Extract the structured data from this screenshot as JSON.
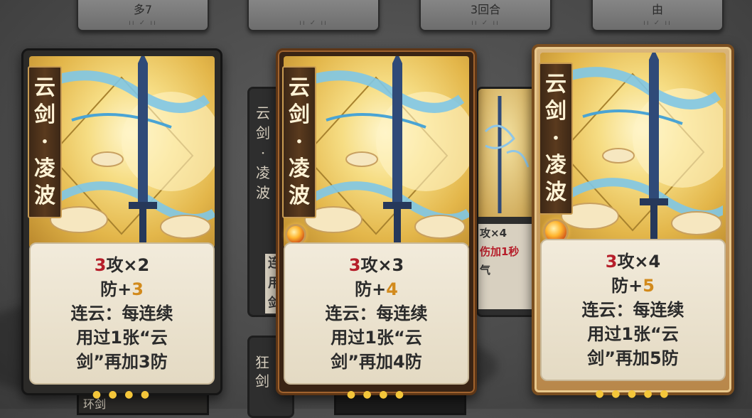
{
  "top_tabs": [
    {
      "label": "多7",
      "ticks": "ıı ✓ ıı"
    },
    {
      "label": "",
      "ticks": "ıı ✓ ıı"
    },
    {
      "label": "3回合",
      "ticks": "ıı ✓ ıı"
    },
    {
      "label": "由",
      "ticks": "ıı ✓ ıı"
    }
  ],
  "background_cards": [
    {
      "title_chars": [
        "云",
        "剑",
        "·",
        "凌",
        "波"
      ],
      "snippet": [
        "连",
        "用",
        "剑"
      ]
    },
    {
      "snippet": [
        "攻×4",
        "伤加1秒",
        "气"
      ]
    },
    {
      "title_chars": [
        "狂",
        "剑"
      ]
    }
  ],
  "cards": [
    {
      "name_chars": [
        "云",
        "剑",
        "·",
        "凌",
        "波"
      ],
      "attack_base": "3",
      "attack_mult": "攻×2",
      "defense_prefix": "防+",
      "defense_val": "3",
      "effect_lines": [
        "连云：每连续",
        "用过1张“云",
        "剑”再加3防"
      ],
      "level_dots": "● ● ● ●",
      "style": "plain"
    },
    {
      "name_chars": [
        "云",
        "剑",
        "·",
        "凌",
        "波"
      ],
      "attack_base": "3",
      "attack_mult": "攻×3",
      "defense_prefix": "防+",
      "defense_val": "4",
      "effect_lines": [
        "连云：每连续",
        "用过1张“云",
        "剑”再加4防"
      ],
      "level_dots": "● ● ● ●",
      "style": "bronze"
    },
    {
      "name_chars": [
        "云",
        "剑",
        "·",
        "凌",
        "波"
      ],
      "attack_base": "3",
      "attack_mult": "攻×4",
      "defense_prefix": "防+",
      "defense_val": "5",
      "effect_lines": [
        "连云：每连续",
        "用过1张“云",
        "剑”再加5防"
      ],
      "level_dots": "● ● ● ● ●",
      "style": "gold"
    }
  ],
  "bottom_strips": [
    {
      "label": "环剑"
    },
    {
      "label": ""
    }
  ],
  "colors": {
    "attack_number": "#b61e2a",
    "defense_number": "#d28a1c",
    "card_text": "#2b2b2b",
    "art_gold": "#e3b64a",
    "sword_blue": "#2f4a78"
  }
}
